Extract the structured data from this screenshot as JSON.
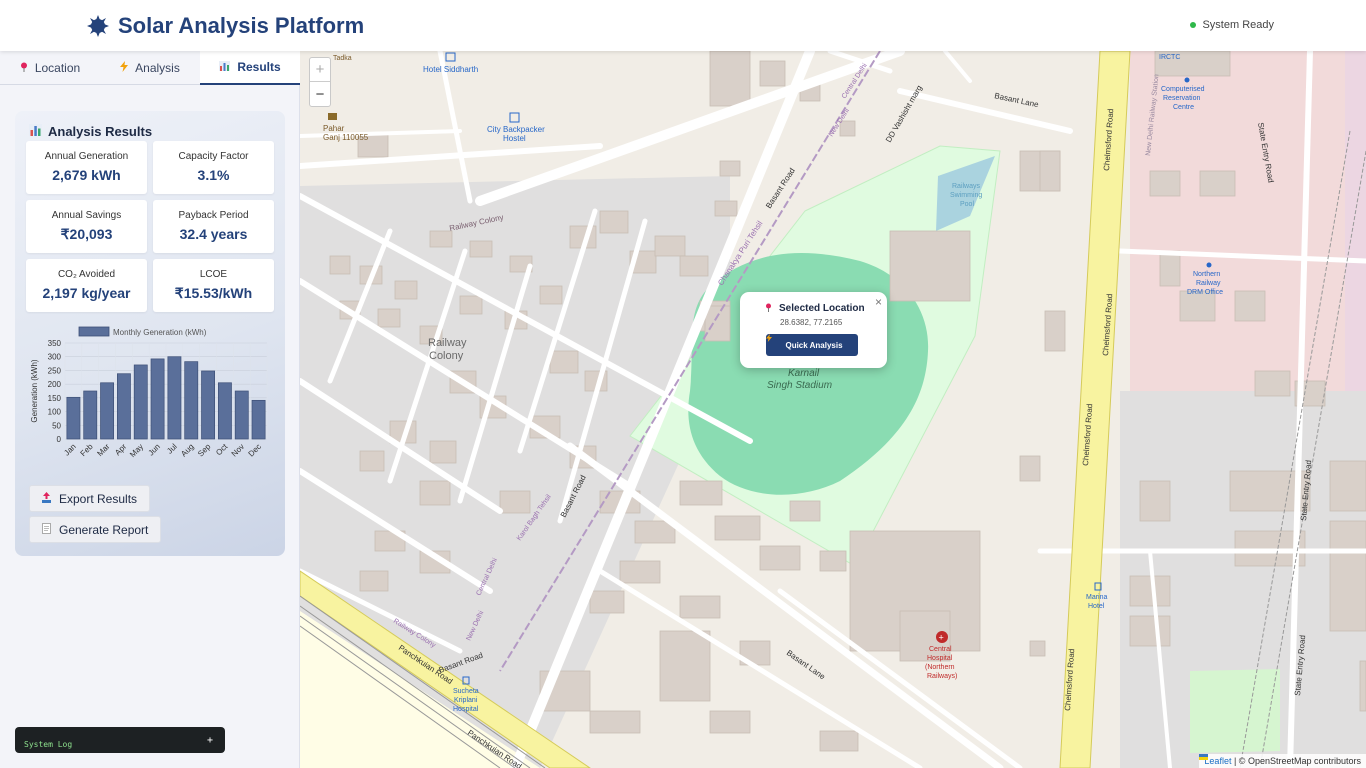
{
  "header": {
    "title": "Solar Analysis Platform",
    "status": "System Ready",
    "status_color": "#2fb84a",
    "brand_color": "#24427a"
  },
  "tabs": [
    {
      "label": "Location",
      "icon": "pin-icon",
      "active": false
    },
    {
      "label": "Analysis",
      "icon": "lightning-icon",
      "active": false
    },
    {
      "label": "Results",
      "icon": "bar-chart-icon",
      "active": true
    }
  ],
  "results": {
    "title": "Analysis Results",
    "metrics": [
      {
        "label": "Annual Generation",
        "value": "2,679 kWh"
      },
      {
        "label": "Capacity Factor",
        "value": "3.1%"
      },
      {
        "label": "Annual Savings",
        "value": "₹20,093"
      },
      {
        "label": "Payback Period",
        "value": "32.4 years"
      },
      {
        "label": "CO₂ Avoided",
        "value": "2,197 kg/year"
      },
      {
        "label": "LCOE",
        "value": "₹15.53/kWh"
      }
    ],
    "export_label": "Export Results",
    "report_label": "Generate Report"
  },
  "chart_data": {
    "type": "bar",
    "legend": "Monthly Generation (kWh)",
    "legend_position": "top",
    "categories": [
      "Jan",
      "Feb",
      "Mar",
      "Apr",
      "May",
      "Jun",
      "Jul",
      "Aug",
      "Sep",
      "Oct",
      "Nov",
      "Dec"
    ],
    "values": [
      152,
      175,
      205,
      238,
      270,
      292,
      300,
      282,
      248,
      205,
      175,
      141
    ],
    "ylabel": "Generation (kWh)",
    "yticks": [
      0,
      50,
      100,
      150,
      200,
      250,
      300,
      350
    ],
    "ylim": [
      0,
      350
    ],
    "grid": true,
    "bar_color": "#5a6f9a"
  },
  "system_log": {
    "label": "System Log",
    "toggle": "+"
  },
  "map": {
    "zoom_in": "+",
    "zoom_out": "−",
    "popup": {
      "title": "Selected Location",
      "coords": "28.6382, 77.2165",
      "button": "Quick Analysis",
      "close": "×"
    },
    "labels": {
      "hotel_siddharth": "Hotel Siddharth",
      "city_backpacker_1": "City Backpacker",
      "city_backpacker_2": "Hostel",
      "pahar_ganj_1": "Pahar",
      "pahar_ganj_2": "Ganj 110055",
      "tadka": "Tadka",
      "railway_colony_road": "Railway Colony",
      "railway_colony_area_1": "Railway",
      "railway_colony_area_2": "Colony",
      "chanakya_puri": "Chanakya Puri Tehsil",
      "basant_road_1": "Basant Road",
      "basant_road_2": "Basant Road",
      "basant_road_3": "Basant Road",
      "basant_lane_1": "Basant Lane",
      "basant_lane_2": "Basant Lane",
      "dd_vashisht": "DD Vashisht marg",
      "central_delhi_1": "Central Delhi",
      "new_delhi_1": "New Delhi",
      "central_delhi_2": "Central Delhi",
      "new_delhi_2": "New Delhi",
      "karol_bagh": "Karol Bagh Tehsil",
      "railway_pool_1": "Railways",
      "railway_pool_2": "Swimming",
      "railway_pool_3": "Pool",
      "stadium_1": "Karnail",
      "stadium_2": "Singh Stadium",
      "chelmsford_1": "Chelmsford Road",
      "chelmsford_2": "Chelmsford Road",
      "chelmsford_3": "Chelmsford Road",
      "chelmsford_4": "Chelmsford Road",
      "irctc": "IRCTC",
      "comp_res_1": "Computerised",
      "comp_res_2": "Reservation",
      "comp_res_3": "Centre",
      "nd_station": "New Delhi Railway Station",
      "state_entry_1": "State Entry Road",
      "state_entry_2": "State Entry Road",
      "state_entry_3": "State Entry Road",
      "drm_1": "Northern",
      "drm_2": "Railway",
      "drm_3": "DRM Office",
      "marina_1": "Marina",
      "marina_2": "Hotel",
      "hospital_1": "Central",
      "hospital_2": "Hospital",
      "hospital_3": "(Northern",
      "hospital_4": "Railways)",
      "sucheta_1": "Sucheta",
      "sucheta_2": "Kriplani",
      "sucheta_3": "Hospital",
      "panchkuian_1": "Panchkuian Road",
      "panchkuian_2": "Panchkuian Road",
      "railway_colony_road_2": "Railway Colony"
    },
    "attribution_link": "Leaflet",
    "attribution_text": "| © OpenStreetMap contributors"
  }
}
